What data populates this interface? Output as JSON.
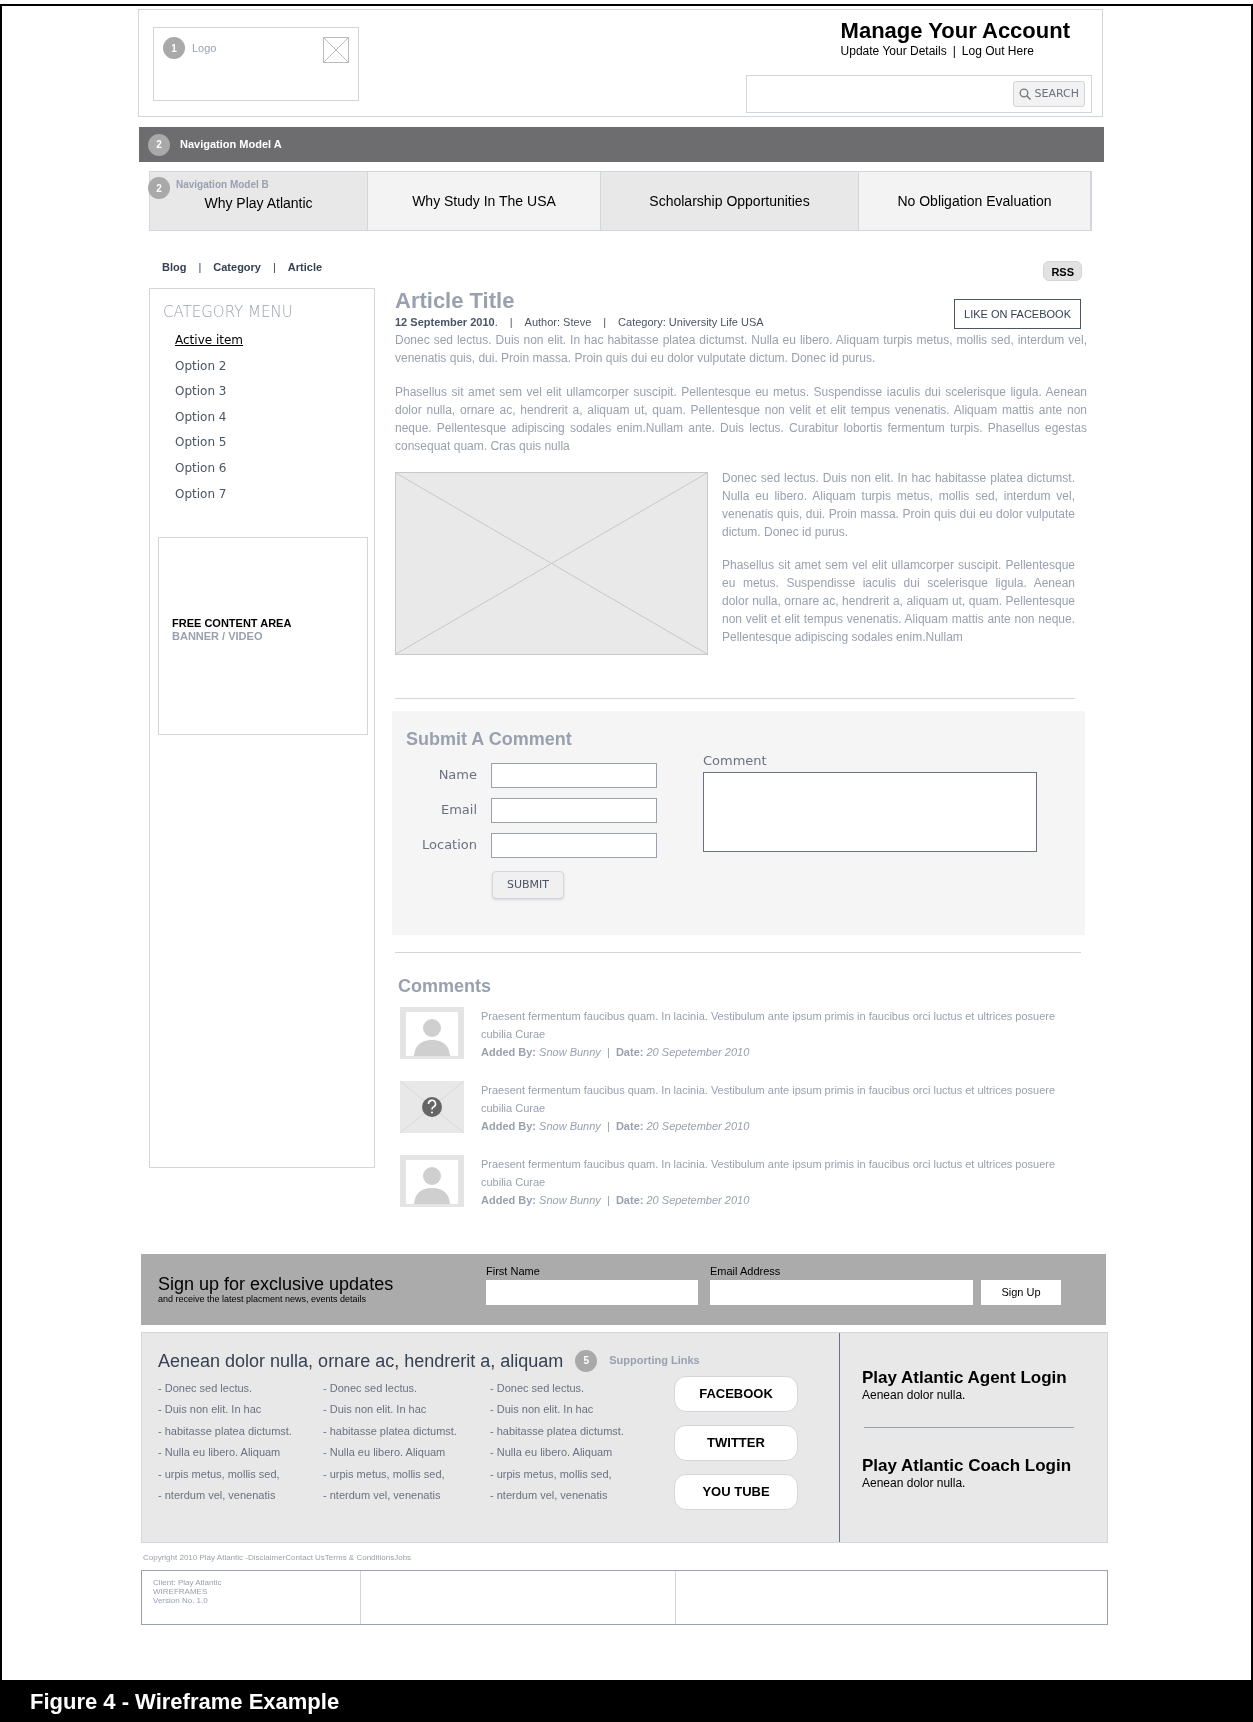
{
  "header": {
    "logo": {
      "badge": "1",
      "label": "Logo"
    },
    "account_title": "Manage Your Account",
    "account_links": [
      "Update Your Details",
      "Log Out Here"
    ],
    "separator": "|",
    "search_button": "SEARCH"
  },
  "nav_a": {
    "badge": "2",
    "label": "Navigation Model A"
  },
  "nav_b": {
    "badge": "2",
    "label": "Navigation Model B",
    "items": [
      "Why Play Atlantic",
      "Why Study In The USA",
      "Scholarship Opportunities",
      "No Obligation Evaluation"
    ]
  },
  "breadcrumb": {
    "items": [
      "Blog",
      "Category",
      "Article"
    ],
    "separator": "|"
  },
  "rss": "RSS",
  "category_menu": {
    "title": "CATEGORY MENU",
    "items": [
      {
        "label": "Active item",
        "selected": true
      },
      {
        "label": "Option 2",
        "selected": false
      },
      {
        "label": "Option 3",
        "selected": false
      },
      {
        "label": "Option 4",
        "selected": false
      },
      {
        "label": "Option 5",
        "selected": false
      },
      {
        "label": "Option 6",
        "selected": false
      },
      {
        "label": "Option 7",
        "selected": false
      }
    ]
  },
  "free_content": {
    "title": "FREE CONTENT AREA",
    "subtitle": "BANNER / VIDEO"
  },
  "article": {
    "title": "Article Title",
    "meta": [
      "**12 September 2010**.",
      "Author: Steve",
      "Category: University Life USA"
    ],
    "separator": "|",
    "like_button": "LIKE ON FACEBOOK",
    "paragraphs": [
      "Donec sed lectus. Duis non elit. In hac habitasse platea dictumst. Nulla eu libero. Aliquam turpis metus, mollis sed, interdum vel, venenatis quis, dui. Proin massa. Proin quis dui eu dolor vulputate dictum. Donec id purus.",
      "Phasellus sit amet sem vel elit ullamcorper suscipit. Pellentesque eu metus. Suspendisse iaculis dui scelerisque ligula. Aenean dolor nulla, ornare ac, hendrerit a, aliquam ut, quam. Pellentesque non velit et elit tempus venenatis. Aliquam mattis ante non neque. Pellentesque adipiscing sodales enim.Nullam ante. Duis lectus. Curabitur lobortis fermentum turpis. Phasellus egestas consequat quam. Cras quis nulla"
    ],
    "side_paragraphs": [
      "Donec sed lectus. Duis non elit. In hac habitasse platea dictumst. Nulla eu libero. Aliquam turpis metus, mollis sed, interdum vel, venenatis quis, dui. Proin massa. Proin quis dui eu dolor vulputate dictum. Donec id purus.",
      "Phasellus sit amet sem vel elit ullamcorper suscipit. Pellentesque eu metus. Suspendisse iaculis dui scelerisque ligula. Aenean dolor nulla, ornare ac, hendrerit a, aliquam ut, quam. Pellentesque non velit et elit tempus venenatis. Aliquam mattis ante non neque. Pellentesque adipiscing sodales enim.Nullam"
    ]
  },
  "comment_form": {
    "title": "Submit A Comment",
    "fields": [
      "Name",
      "Email",
      "Location"
    ],
    "comment_label": "Comment",
    "submit": "SUBMIT"
  },
  "comments": {
    "title": "Comments",
    "items": [
      {
        "kind": "person",
        "text": "Praesent fermentum faucibus quam. In lacinia. Vestibulum ante ipsum primis in faucibus orci luctus et ultrices posuere cubilia Curae",
        "byline": "**Added By:** *Snow Bunny*  |  **Date:** *20 Sepetember 2010*"
      },
      {
        "kind": "unknown",
        "text": "Praesent fermentum faucibus quam. In lacinia. Vestibulum ante ipsum primis in faucibus orci luctus et ultrices posuere cubilia Curae",
        "byline": "**Added By:** *Snow Bunny*  |  **Date:** *20 Sepetember 2010*"
      },
      {
        "kind": "person",
        "text": "Praesent fermentum faucibus quam. In lacinia. Vestibulum ante ipsum primis in faucibus orci luctus et ultrices posuere cubilia Curae",
        "byline": "**Added By:** *Snow Bunny*  |  **Date:** *20 Sepetember 2010*"
      }
    ]
  },
  "signup": {
    "title": "Sign up for exclusive updates",
    "subtitle": "and receive the latest placment news, events details",
    "fields": [
      "First Name",
      "Email Address"
    ],
    "button": "Sign Up"
  },
  "footer": {
    "heading": "Aenean dolor nulla, ornare ac, hendrerit a, aliquam",
    "badge": "5",
    "badge_label": "Supporting Links",
    "link_columns": [
      [
        "- Donec sed lectus.",
        "- Duis non elit. In hac",
        "- habitasse platea dictumst.",
        "- Nulla eu libero. Aliquam",
        "- urpis metus, mollis sed,",
        "- nterdum vel, venenatis"
      ],
      [
        "- Donec sed lectus.",
        "- Duis non elit. In hac",
        "- habitasse platea dictumst.",
        "- Nulla eu libero. Aliquam",
        "- urpis metus, mollis sed,",
        "- nterdum vel, venenatis"
      ],
      [
        "- Donec sed lectus.",
        "- Duis non elit. In hac",
        "- habitasse platea dictumst.",
        "- Nulla eu libero. Aliquam",
        "- urpis metus, mollis sed,",
        "- nterdum vel, venenatis"
      ]
    ],
    "social": [
      "FACEBOOK",
      "TWITTER",
      "YOU TUBE"
    ],
    "logins": [
      {
        "title": "Play Atlantic Agent Login",
        "text": "Aenean dolor nulla."
      },
      {
        "title": "Play Atlantic Coach Login",
        "text": "Aenean dolor nulla."
      }
    ]
  },
  "copyright": "Copyright 2010 Play Atlantic  -DisclaimerContact UsTerms & ConditionsJobs",
  "client_box": [
    "Client: Play Atlantic",
    "WIREFRAMES",
    "Version No. 1.0"
  ],
  "caption": "Figure 4 - Wireframe Example"
}
